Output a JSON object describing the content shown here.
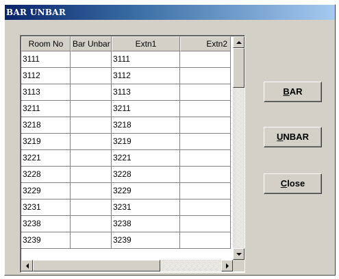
{
  "window": {
    "title": "BAR UNBAR"
  },
  "grid": {
    "columns": [
      "Room No",
      "Bar Unbar",
      "Extn1",
      "Extn2"
    ],
    "rows": [
      {
        "room": "3111",
        "bar": "",
        "extn1": "3111",
        "extn2": ""
      },
      {
        "room": "3112",
        "bar": "",
        "extn1": "3112",
        "extn2": ""
      },
      {
        "room": "3113",
        "bar": "",
        "extn1": "3113",
        "extn2": ""
      },
      {
        "room": "3211",
        "bar": "",
        "extn1": "3211",
        "extn2": ""
      },
      {
        "room": "3218",
        "bar": "",
        "extn1": "3218",
        "extn2": ""
      },
      {
        "room": "3219",
        "bar": "",
        "extn1": "3219",
        "extn2": ""
      },
      {
        "room": "3221",
        "bar": "",
        "extn1": "3221",
        "extn2": ""
      },
      {
        "room": "3228",
        "bar": "",
        "extn1": "3228",
        "extn2": ""
      },
      {
        "room": "3229",
        "bar": "",
        "extn1": "3229",
        "extn2": ""
      },
      {
        "room": "3231",
        "bar": "",
        "extn1": "3231",
        "extn2": ""
      },
      {
        "room": "3238",
        "bar": "",
        "extn1": "3238",
        "extn2": ""
      },
      {
        "room": "3239",
        "bar": "",
        "extn1": "3239",
        "extn2": ""
      }
    ]
  },
  "buttons": {
    "bar": {
      "mnemonic": "B",
      "rest": "AR"
    },
    "unbar": {
      "mnemonic": "U",
      "rest": "NBAR"
    },
    "close": {
      "mnemonic": "C",
      "rest": "lose"
    }
  },
  "icons": {
    "scroll_up": "scroll-up-arrow-icon",
    "scroll_down": "scroll-down-arrow-icon",
    "scroll_left": "scroll-left-arrow-icon",
    "scroll_right": "scroll-right-arrow-icon"
  },
  "colors": {
    "title_start": "#0a246a",
    "title_end": "#a6caf0",
    "face": "#d4d0c8"
  }
}
